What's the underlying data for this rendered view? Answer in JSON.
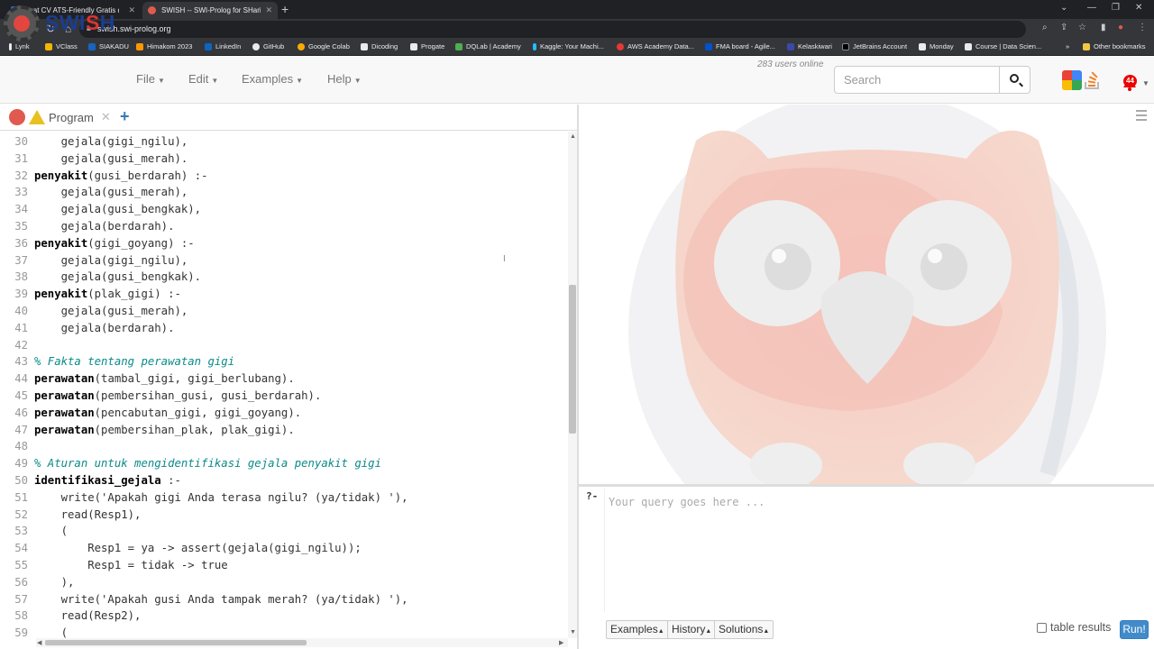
{
  "browser": {
    "tabs": [
      {
        "title": "Buat CV ATS-Friendly Gratis di Ki",
        "active": false
      },
      {
        "title": "SWISH -- SWI-Prolog for SHaring",
        "active": true
      }
    ],
    "url": "swish.swi-prolog.org",
    "bookmarks": [
      "Lynk",
      "VClass",
      "SIAKADU",
      "Himakom 2023",
      "LinkedIn",
      "GitHub",
      "Google Colab",
      "Dicoding",
      "Progate",
      "DQLab | Academy",
      "Kaggle: Your Machi...",
      "AWS Academy Data...",
      "FMA board - Agile...",
      "Kelaskiwari",
      "JetBrains Account",
      "Monday",
      "Course | Data Scien..."
    ],
    "other_bookmarks": "Other bookmarks"
  },
  "header": {
    "logo_a": "SWI",
    "logo_b": "S",
    "logo_c": "H",
    "menus": [
      "File",
      "Edit",
      "Examples",
      "Help"
    ],
    "users_online": "283 users online",
    "search_placeholder": "Search",
    "notification_count": "44"
  },
  "editor": {
    "tab_label": "Program",
    "lines": [
      {
        "n": "30",
        "t": "    gejala(gigi_ngilu),",
        "k": "code"
      },
      {
        "n": "31",
        "t": "    gejala(gusi_merah).",
        "k": "code"
      },
      {
        "n": "32",
        "t": "penyakit(gusi_berdarah) :-",
        "k": "head"
      },
      {
        "n": "33",
        "t": "    gejala(gusi_merah),",
        "k": "code"
      },
      {
        "n": "34",
        "t": "    gejala(gusi_bengkak),",
        "k": "code"
      },
      {
        "n": "35",
        "t": "    gejala(berdarah).",
        "k": "code"
      },
      {
        "n": "36",
        "t": "penyakit(gigi_goyang) :-",
        "k": "head"
      },
      {
        "n": "37",
        "t": "    gejala(gigi_ngilu),",
        "k": "code"
      },
      {
        "n": "38",
        "t": "    gejala(gusi_bengkak).",
        "k": "code"
      },
      {
        "n": "39",
        "t": "penyakit(plak_gigi) :-",
        "k": "head"
      },
      {
        "n": "40",
        "t": "    gejala(gusi_merah),",
        "k": "code"
      },
      {
        "n": "41",
        "t": "    gejala(berdarah).",
        "k": "code"
      },
      {
        "n": "42",
        "t": "",
        "k": "code"
      },
      {
        "n": "43",
        "t": "% Fakta tentang perawatan gigi",
        "k": "comment"
      },
      {
        "n": "44",
        "t": "perawatan(tambal_gigi, gigi_berlubang).",
        "k": "head"
      },
      {
        "n": "45",
        "t": "perawatan(pembersihan_gusi, gusi_berdarah).",
        "k": "head"
      },
      {
        "n": "46",
        "t": "perawatan(pencabutan_gigi, gigi_goyang).",
        "k": "head"
      },
      {
        "n": "47",
        "t": "perawatan(pembersihan_plak, plak_gigi).",
        "k": "head"
      },
      {
        "n": "48",
        "t": "",
        "k": "code"
      },
      {
        "n": "49",
        "t": "% Aturan untuk mengidentifikasi gejala penyakit gigi",
        "k": "comment"
      },
      {
        "n": "50",
        "t": "identifikasi_gejala :-",
        "k": "headfull"
      },
      {
        "n": "51",
        "t": "    write('Apakah gigi Anda terasa ngilu? (ya/tidak) '),",
        "k": "code"
      },
      {
        "n": "52",
        "t": "    read(Resp1),",
        "k": "code"
      },
      {
        "n": "53",
        "t": "    (",
        "k": "code"
      },
      {
        "n": "54",
        "t": "        Resp1 = ya -> assert(gejala(gigi_ngilu));",
        "k": "code"
      },
      {
        "n": "55",
        "t": "        Resp1 = tidak -> true",
        "k": "code"
      },
      {
        "n": "56",
        "t": "    ),",
        "k": "code"
      },
      {
        "n": "57",
        "t": "    write('Apakah gusi Anda tampak merah? (ya/tidak) '),",
        "k": "code"
      },
      {
        "n": "58",
        "t": "    read(Resp2),",
        "k": "code"
      },
      {
        "n": "59",
        "t": "    (",
        "k": "code"
      }
    ]
  },
  "query": {
    "prompt": "?-",
    "placeholder": "Your query goes here ...",
    "buttons": [
      "Examples",
      "History",
      "Solutions"
    ],
    "table_results_label": "table results",
    "run_label": "Run!"
  }
}
